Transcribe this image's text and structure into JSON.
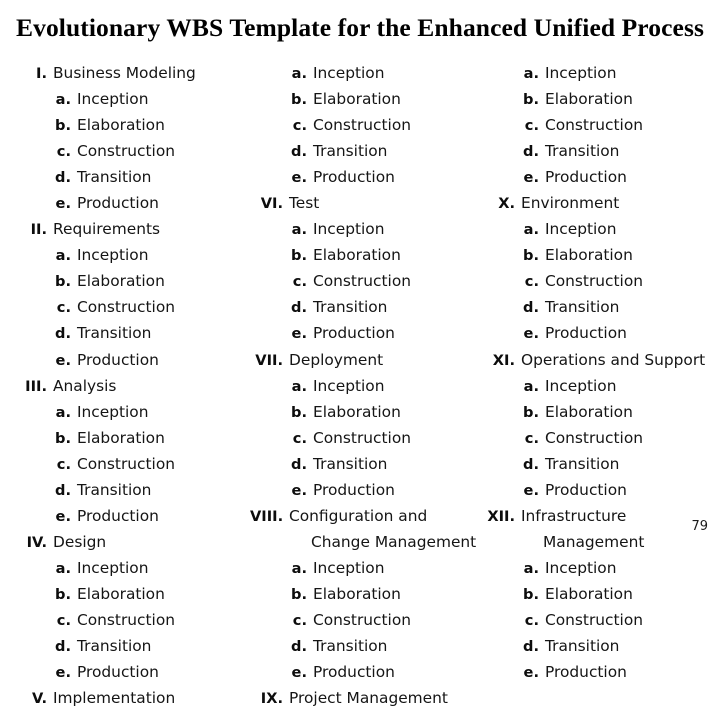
{
  "slide": {
    "title": "Evolutionary WBS Template for the Enhanced Unified Process",
    "page_number": "79"
  },
  "columns": [
    {
      "id": "column-1",
      "entries": [
        {
          "level": 1,
          "marker": "I.",
          "label": "Business Modeling"
        },
        {
          "level": 2,
          "marker": "a.",
          "label": "Inception"
        },
        {
          "level": 2,
          "marker": "b.",
          "label": "Elaboration"
        },
        {
          "level": 2,
          "marker": "c.",
          "label": "Construction"
        },
        {
          "level": 2,
          "marker": "d.",
          "label": "Transition"
        },
        {
          "level": 2,
          "marker": "e.",
          "label": "Production"
        },
        {
          "level": 1,
          "marker": "II.",
          "label": "Requirements"
        },
        {
          "level": 2,
          "marker": "a.",
          "label": "Inception"
        },
        {
          "level": 2,
          "marker": "b.",
          "label": "Elaboration"
        },
        {
          "level": 2,
          "marker": "c.",
          "label": "Construction"
        },
        {
          "level": 2,
          "marker": "d.",
          "label": "Transition"
        },
        {
          "level": 2,
          "marker": "e.",
          "label": "Production"
        },
        {
          "level": 1,
          "marker": "III.",
          "label": "Analysis"
        },
        {
          "level": 2,
          "marker": "a.",
          "label": "Inception"
        },
        {
          "level": 2,
          "marker": "b.",
          "label": "Elaboration"
        },
        {
          "level": 2,
          "marker": "c.",
          "label": "Construction"
        },
        {
          "level": 2,
          "marker": "d.",
          "label": "Transition"
        },
        {
          "level": 2,
          "marker": "e.",
          "label": "Production"
        },
        {
          "level": 1,
          "marker": "IV.",
          "label": "Design"
        },
        {
          "level": 2,
          "marker": "a.",
          "label": "Inception"
        },
        {
          "level": 2,
          "marker": "b.",
          "label": "Elaboration"
        },
        {
          "level": 2,
          "marker": "c.",
          "label": "Construction"
        },
        {
          "level": 2,
          "marker": "d.",
          "label": "Transition"
        },
        {
          "level": 2,
          "marker": "e.",
          "label": "Production"
        },
        {
          "level": 1,
          "marker": "V.",
          "label": "Implementation"
        }
      ]
    },
    {
      "id": "column-2",
      "entries": [
        {
          "level": 2,
          "marker": "a.",
          "label": "Inception"
        },
        {
          "level": 2,
          "marker": "b.",
          "label": "Elaboration"
        },
        {
          "level": 2,
          "marker": "c.",
          "label": "Construction"
        },
        {
          "level": 2,
          "marker": "d.",
          "label": "Transition"
        },
        {
          "level": 2,
          "marker": "e.",
          "label": "Production"
        },
        {
          "level": 1,
          "marker": "VI.",
          "label": "Test"
        },
        {
          "level": 2,
          "marker": "a.",
          "label": "Inception"
        },
        {
          "level": 2,
          "marker": "b.",
          "label": "Elaboration"
        },
        {
          "level": 2,
          "marker": "c.",
          "label": "Construction"
        },
        {
          "level": 2,
          "marker": "d.",
          "label": "Transition"
        },
        {
          "level": 2,
          "marker": "e.",
          "label": "Production"
        },
        {
          "level": 1,
          "marker": "VII.",
          "label": "Deployment"
        },
        {
          "level": 2,
          "marker": "a.",
          "label": "Inception"
        },
        {
          "level": 2,
          "marker": "b.",
          "label": "Elaboration"
        },
        {
          "level": 2,
          "marker": "c.",
          "label": "Construction"
        },
        {
          "level": 2,
          "marker": "d.",
          "label": "Transition"
        },
        {
          "level": 2,
          "marker": "e.",
          "label": "Production"
        },
        {
          "level": 1,
          "marker": "VIII.",
          "label": "Configuration and"
        },
        {
          "level": 0,
          "marker": "",
          "label": "Change Management"
        },
        {
          "level": 2,
          "marker": "a.",
          "label": "Inception"
        },
        {
          "level": 2,
          "marker": "b.",
          "label": "Elaboration"
        },
        {
          "level": 2,
          "marker": "c.",
          "label": "Construction"
        },
        {
          "level": 2,
          "marker": "d.",
          "label": "Transition"
        },
        {
          "level": 2,
          "marker": "e.",
          "label": "Production"
        },
        {
          "level": 1,
          "marker": "IX.",
          "label": "Project Management"
        }
      ]
    },
    {
      "id": "column-3",
      "entries": [
        {
          "level": 2,
          "marker": "a.",
          "label": "Inception"
        },
        {
          "level": 2,
          "marker": "b.",
          "label": "Elaboration"
        },
        {
          "level": 2,
          "marker": "c.",
          "label": "Construction"
        },
        {
          "level": 2,
          "marker": "d.",
          "label": "Transition"
        },
        {
          "level": 2,
          "marker": "e.",
          "label": "Production"
        },
        {
          "level": 1,
          "marker": "X.",
          "label": "Environment"
        },
        {
          "level": 2,
          "marker": "a.",
          "label": "Inception"
        },
        {
          "level": 2,
          "marker": "b.",
          "label": "Elaboration"
        },
        {
          "level": 2,
          "marker": "c.",
          "label": "Construction"
        },
        {
          "level": 2,
          "marker": "d.",
          "label": "Transition"
        },
        {
          "level": 2,
          "marker": "e.",
          "label": "Production"
        },
        {
          "level": 1,
          "marker": "XI.",
          "label": "Operations and Support"
        },
        {
          "level": 2,
          "marker": "a.",
          "label": "Inception"
        },
        {
          "level": 2,
          "marker": "b.",
          "label": "Elaboration"
        },
        {
          "level": 2,
          "marker": "c.",
          "label": "Construction"
        },
        {
          "level": 2,
          "marker": "d.",
          "label": "Transition"
        },
        {
          "level": 2,
          "marker": "e.",
          "label": "Production"
        },
        {
          "level": 1,
          "marker": "XII.",
          "label": "Infrastructure"
        },
        {
          "level": 0,
          "marker": "",
          "label": "Management"
        },
        {
          "level": 2,
          "marker": "a.",
          "label": "Inception"
        },
        {
          "level": 2,
          "marker": "b.",
          "label": "Elaboration"
        },
        {
          "level": 2,
          "marker": "c.",
          "label": "Construction"
        },
        {
          "level": 2,
          "marker": "d.",
          "label": "Transition"
        },
        {
          "level": 2,
          "marker": "e.",
          "label": "Production"
        }
      ]
    }
  ]
}
